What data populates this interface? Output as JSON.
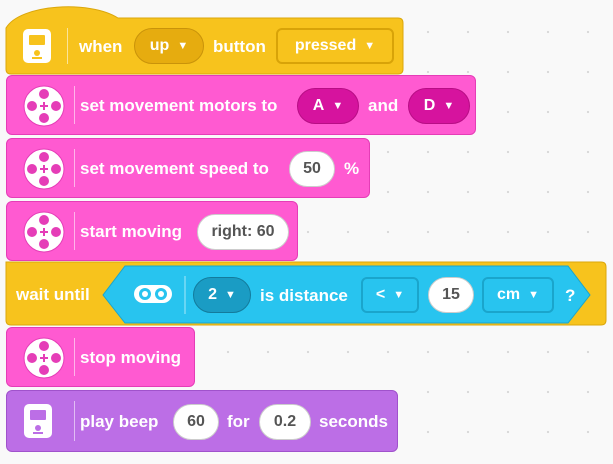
{
  "when_block": {
    "word_when": "when",
    "button_selected": "up",
    "word_button": "button",
    "state_selected": "pressed",
    "icon": "hub-icon"
  },
  "set_motors": {
    "label": "set movement motors to",
    "motor_a": "A",
    "word_and": "and",
    "motor_b": "D",
    "icon": "motor-icon"
  },
  "set_speed": {
    "label": "set movement speed to",
    "value": "50",
    "unit": "%",
    "icon": "motor-icon"
  },
  "start_moving": {
    "label": "start moving",
    "direction": "right: 60",
    "icon": "motor-icon"
  },
  "wait_until": {
    "label": "wait until",
    "sensor_port": "2",
    "word_is_distance": "is distance",
    "comparator": "<",
    "value": "15",
    "unit": "cm",
    "question": "?",
    "icon": "distance-sensor-icon"
  },
  "stop_moving": {
    "label": "stop moving",
    "icon": "motor-icon"
  },
  "play_beep": {
    "label": "play beep",
    "note": "60",
    "word_for": "for",
    "duration": "0.2",
    "word_seconds": "seconds",
    "icon": "hub-icon"
  },
  "colors": {
    "events_yellow": "#f7c31d",
    "motors_pink": "#ff5ad1",
    "sensors_blue": "#28c4ef",
    "sound_purple": "#bc6ee6"
  }
}
